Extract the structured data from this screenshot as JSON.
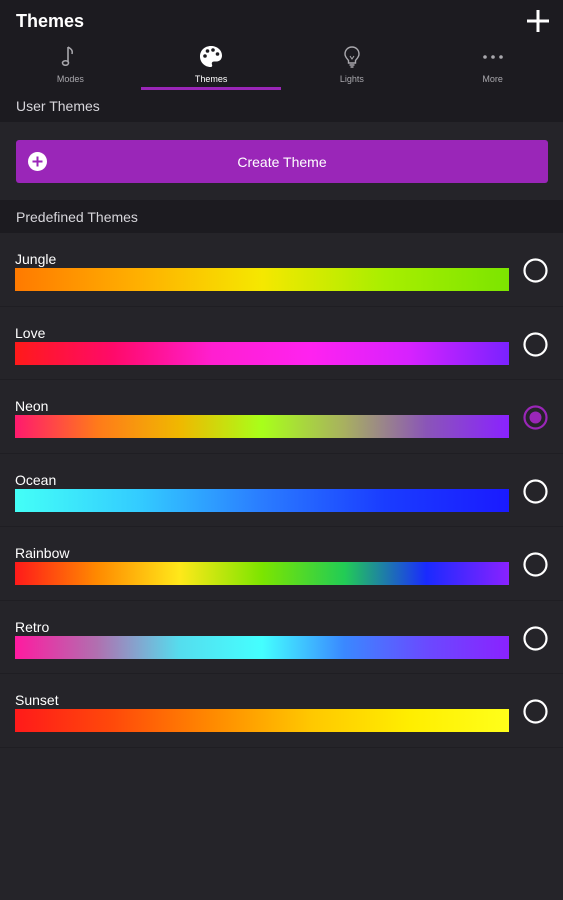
{
  "header": {
    "title": "Themes",
    "add_icon": "plus-icon"
  },
  "tabs": [
    {
      "label": "Modes",
      "icon": "music-note-icon",
      "active": false
    },
    {
      "label": "Themes",
      "icon": "palette-icon",
      "active": true
    },
    {
      "label": "Lights",
      "icon": "lightbulb-icon",
      "active": false
    },
    {
      "label": "More",
      "icon": "more-dots-icon",
      "active": false
    }
  ],
  "user_section": {
    "title": "User Themes",
    "create_label": "Create Theme",
    "create_icon": "plus-circle-icon"
  },
  "predefined_section": {
    "title": "Predefined Themes"
  },
  "themes": [
    {
      "name": "Jungle",
      "selected": false,
      "colors": [
        "#ff7a00",
        "#ffb000",
        "#f5e800",
        "#a8ee00",
        "#7ce500"
      ]
    },
    {
      "name": "Love",
      "selected": false,
      "colors": [
        "#ff1a1a",
        "#ff0a6a",
        "#ff1fd0",
        "#ff22f0",
        "#d622ff",
        "#7a22ff"
      ]
    },
    {
      "name": "Neon",
      "selected": true,
      "colors": [
        "#ff1a6e",
        "#ff7a1a",
        "#f0b800",
        "#a8ff1a",
        "#a8b060",
        "#8a55b8",
        "#8a22ff"
      ]
    },
    {
      "name": "Ocean",
      "selected": false,
      "colors": [
        "#44fff7",
        "#33ccff",
        "#2a7cff",
        "#1a3cff",
        "#1a1aff"
      ]
    },
    {
      "name": "Rainbow",
      "selected": false,
      "colors": [
        "#ff1a1a",
        "#ff8a00",
        "#ffe81a",
        "#7ce500",
        "#22cc55",
        "#1a2aff",
        "#8a22ff"
      ]
    },
    {
      "name": "Retro",
      "selected": false,
      "colors": [
        "#ff1aa0",
        "#b070b0",
        "#55ddee",
        "#44ffff",
        "#3a88ff",
        "#6a4aff",
        "#8a22ff"
      ]
    },
    {
      "name": "Sunset",
      "selected": false,
      "colors": [
        "#ff1a1a",
        "#ff4a0a",
        "#ff8a00",
        "#ffc800",
        "#ffee00",
        "#ffff1a"
      ]
    }
  ],
  "colors": {
    "accent": "#9a26b8",
    "background": "#252429",
    "header_bg": "#1c1b20"
  }
}
